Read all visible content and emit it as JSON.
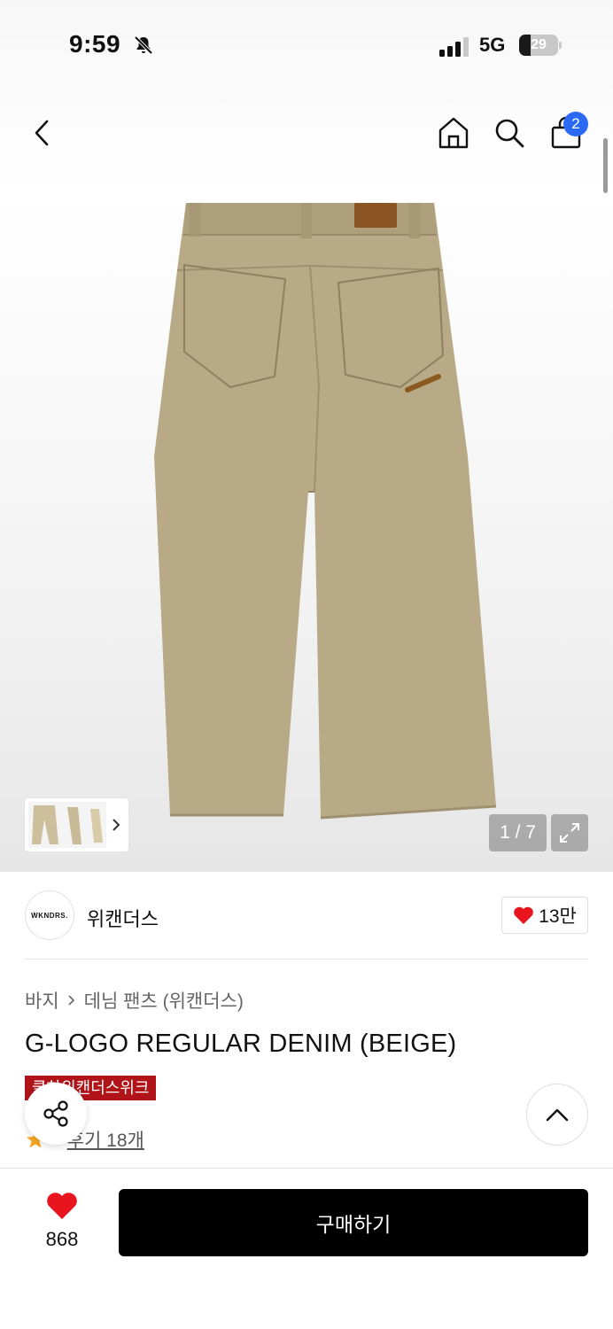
{
  "status_bar": {
    "time": "9:59",
    "network": "5G",
    "battery": "29",
    "battery_level_percent": 29,
    "icons": [
      "bell-slash-icon",
      "signal-bars-icon",
      "battery-icon"
    ]
  },
  "top_nav": {
    "icons": [
      "back-chevron-icon",
      "home-icon",
      "search-icon",
      "shopping-bag-icon"
    ],
    "cart_count": "2"
  },
  "gallery": {
    "pager": "1 / 7",
    "icons": [
      "thumbnail-next-chevron-icon",
      "expand-icon"
    ]
  },
  "brand": {
    "logo_text": "WKNDRS.",
    "name": "위캔더스",
    "likes": "13만"
  },
  "product": {
    "breadcrumb": [
      "바지",
      "데님 팬츠 (위캔더스)"
    ],
    "title": "G-LOGO REGULAR DENIM (BEIGE)",
    "promo_badge": "쿨하위캔더스위크",
    "rating": "5",
    "review_link": "후기 18개"
  },
  "bottom_bar": {
    "wish_count": "868",
    "buy_label": "구매하기"
  },
  "colors": {
    "accent_blue": "#2a6af5",
    "promo_red": "#b01318",
    "heart_red": "#e8141e",
    "star_orange": "#f5a623",
    "pants_beige": "#b8aa86"
  }
}
